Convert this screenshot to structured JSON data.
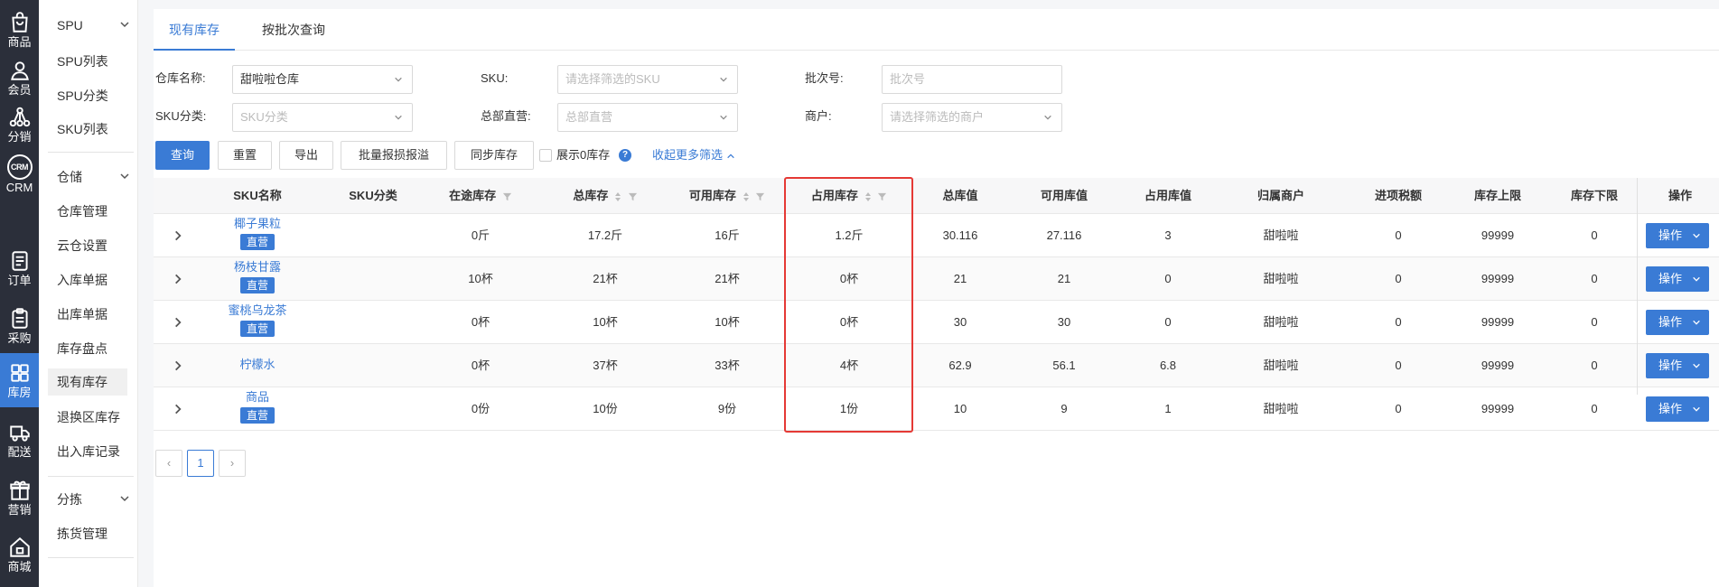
{
  "rail": [
    {
      "label": "商品",
      "icon": "bag-icon"
    },
    {
      "label": "会员",
      "icon": "user-icon"
    },
    {
      "label": "分销",
      "icon": "network-icon"
    },
    {
      "label": "CRM",
      "icon": "crm-icon",
      "icon_text": "CRM"
    },
    {
      "label": "订单",
      "icon": "document-icon"
    },
    {
      "label": "采购",
      "icon": "clipboard-icon"
    },
    {
      "label": "库房",
      "icon": "grid-icon"
    },
    {
      "label": "配送",
      "icon": "truck-icon"
    },
    {
      "label": "营销",
      "icon": "gift-icon"
    },
    {
      "label": "商城",
      "icon": "home-icon"
    }
  ],
  "submenu": {
    "spu_group": "SPU",
    "spu_items": [
      "SPU列表",
      "SPU分类",
      "SKU列表"
    ],
    "warehouse_group": "仓储",
    "warehouse_items": [
      "仓库管理",
      "云仓设置",
      "入库单据",
      "出库单据",
      "库存盘点",
      "现有库存",
      "退换区库存",
      "出入库记录"
    ],
    "sort_group": "分拣",
    "sort_items": [
      "拣货管理"
    ]
  },
  "tabs": [
    "现有库存",
    "按批次查询"
  ],
  "filters": {
    "warehouse": {
      "label": "仓库名称:",
      "value": "甜啦啦仓库"
    },
    "sku": {
      "label": "SKU:",
      "placeholder": "请选择筛选的SKU"
    },
    "batch": {
      "label": "批次号:",
      "placeholder": "批次号"
    },
    "sku_category": {
      "label": "SKU分类:",
      "placeholder": "SKU分类"
    },
    "hq": {
      "label": "总部直营:",
      "placeholder": "总部直营"
    },
    "merchant": {
      "label": "商户:",
      "placeholder": "请选择筛选的商户"
    }
  },
  "actions": {
    "query": "查询",
    "reset": "重置",
    "export": "导出",
    "batch_damage": "批量报损报溢",
    "sync": "同步库存",
    "show_zero": "展示0库存",
    "help": "?",
    "collapse": "收起更多筛选"
  },
  "table": {
    "columns": [
      "SKU名称",
      "SKU分类",
      "在途库存",
      "总库存",
      "可用库存",
      "占用库存",
      "总库值",
      "可用库值",
      "占用库值",
      "归属商户",
      "进项税额",
      "库存上限",
      "库存下限",
      "操作"
    ],
    "rows": [
      {
        "name": "椰子果粒",
        "badge": "直营",
        "category": "",
        "in_transit": "0斤",
        "total": "17.2斤",
        "available": "16斤",
        "occupied": "1.2斤",
        "total_value": "30.116",
        "available_value": "27.116",
        "occupied_value": "3",
        "merchant": "甜啦啦",
        "tax": "0",
        "upper": "99999",
        "lower": "0",
        "op": "操作"
      },
      {
        "name": "杨枝甘露",
        "badge": "直营",
        "category": "",
        "in_transit": "10杯",
        "total": "21杯",
        "available": "21杯",
        "occupied": "0杯",
        "total_value": "21",
        "available_value": "21",
        "occupied_value": "0",
        "merchant": "甜啦啦",
        "tax": "0",
        "upper": "99999",
        "lower": "0",
        "op": "操作"
      },
      {
        "name": "蜜桃乌龙茶",
        "badge": "直营",
        "category": "",
        "in_transit": "0杯",
        "total": "10杯",
        "available": "10杯",
        "occupied": "0杯",
        "total_value": "30",
        "available_value": "30",
        "occupied_value": "0",
        "merchant": "甜啦啦",
        "tax": "0",
        "upper": "99999",
        "lower": "0",
        "op": "操作"
      },
      {
        "name": "柠檬水",
        "badge": "",
        "category": "",
        "in_transit": "0杯",
        "total": "37杯",
        "available": "33杯",
        "occupied": "4杯",
        "total_value": "62.9",
        "available_value": "56.1",
        "occupied_value": "6.8",
        "merchant": "甜啦啦",
        "tax": "0",
        "upper": "99999",
        "lower": "0",
        "op": "操作"
      },
      {
        "name": "商品",
        "badge": "直营",
        "category": "",
        "in_transit": "0份",
        "total": "10份",
        "available": "9份",
        "occupied": "1份",
        "total_value": "10",
        "available_value": "9",
        "occupied_value": "1",
        "merchant": "甜啦啦",
        "tax": "0",
        "upper": "99999",
        "lower": "0",
        "op": "操作"
      }
    ]
  },
  "pagination": {
    "prev": "‹",
    "current": "1",
    "next": "›"
  },
  "colors": {
    "accent": "#3a7bd5",
    "rail_bg": "#2b2f3a",
    "highlight": "#e53935"
  }
}
